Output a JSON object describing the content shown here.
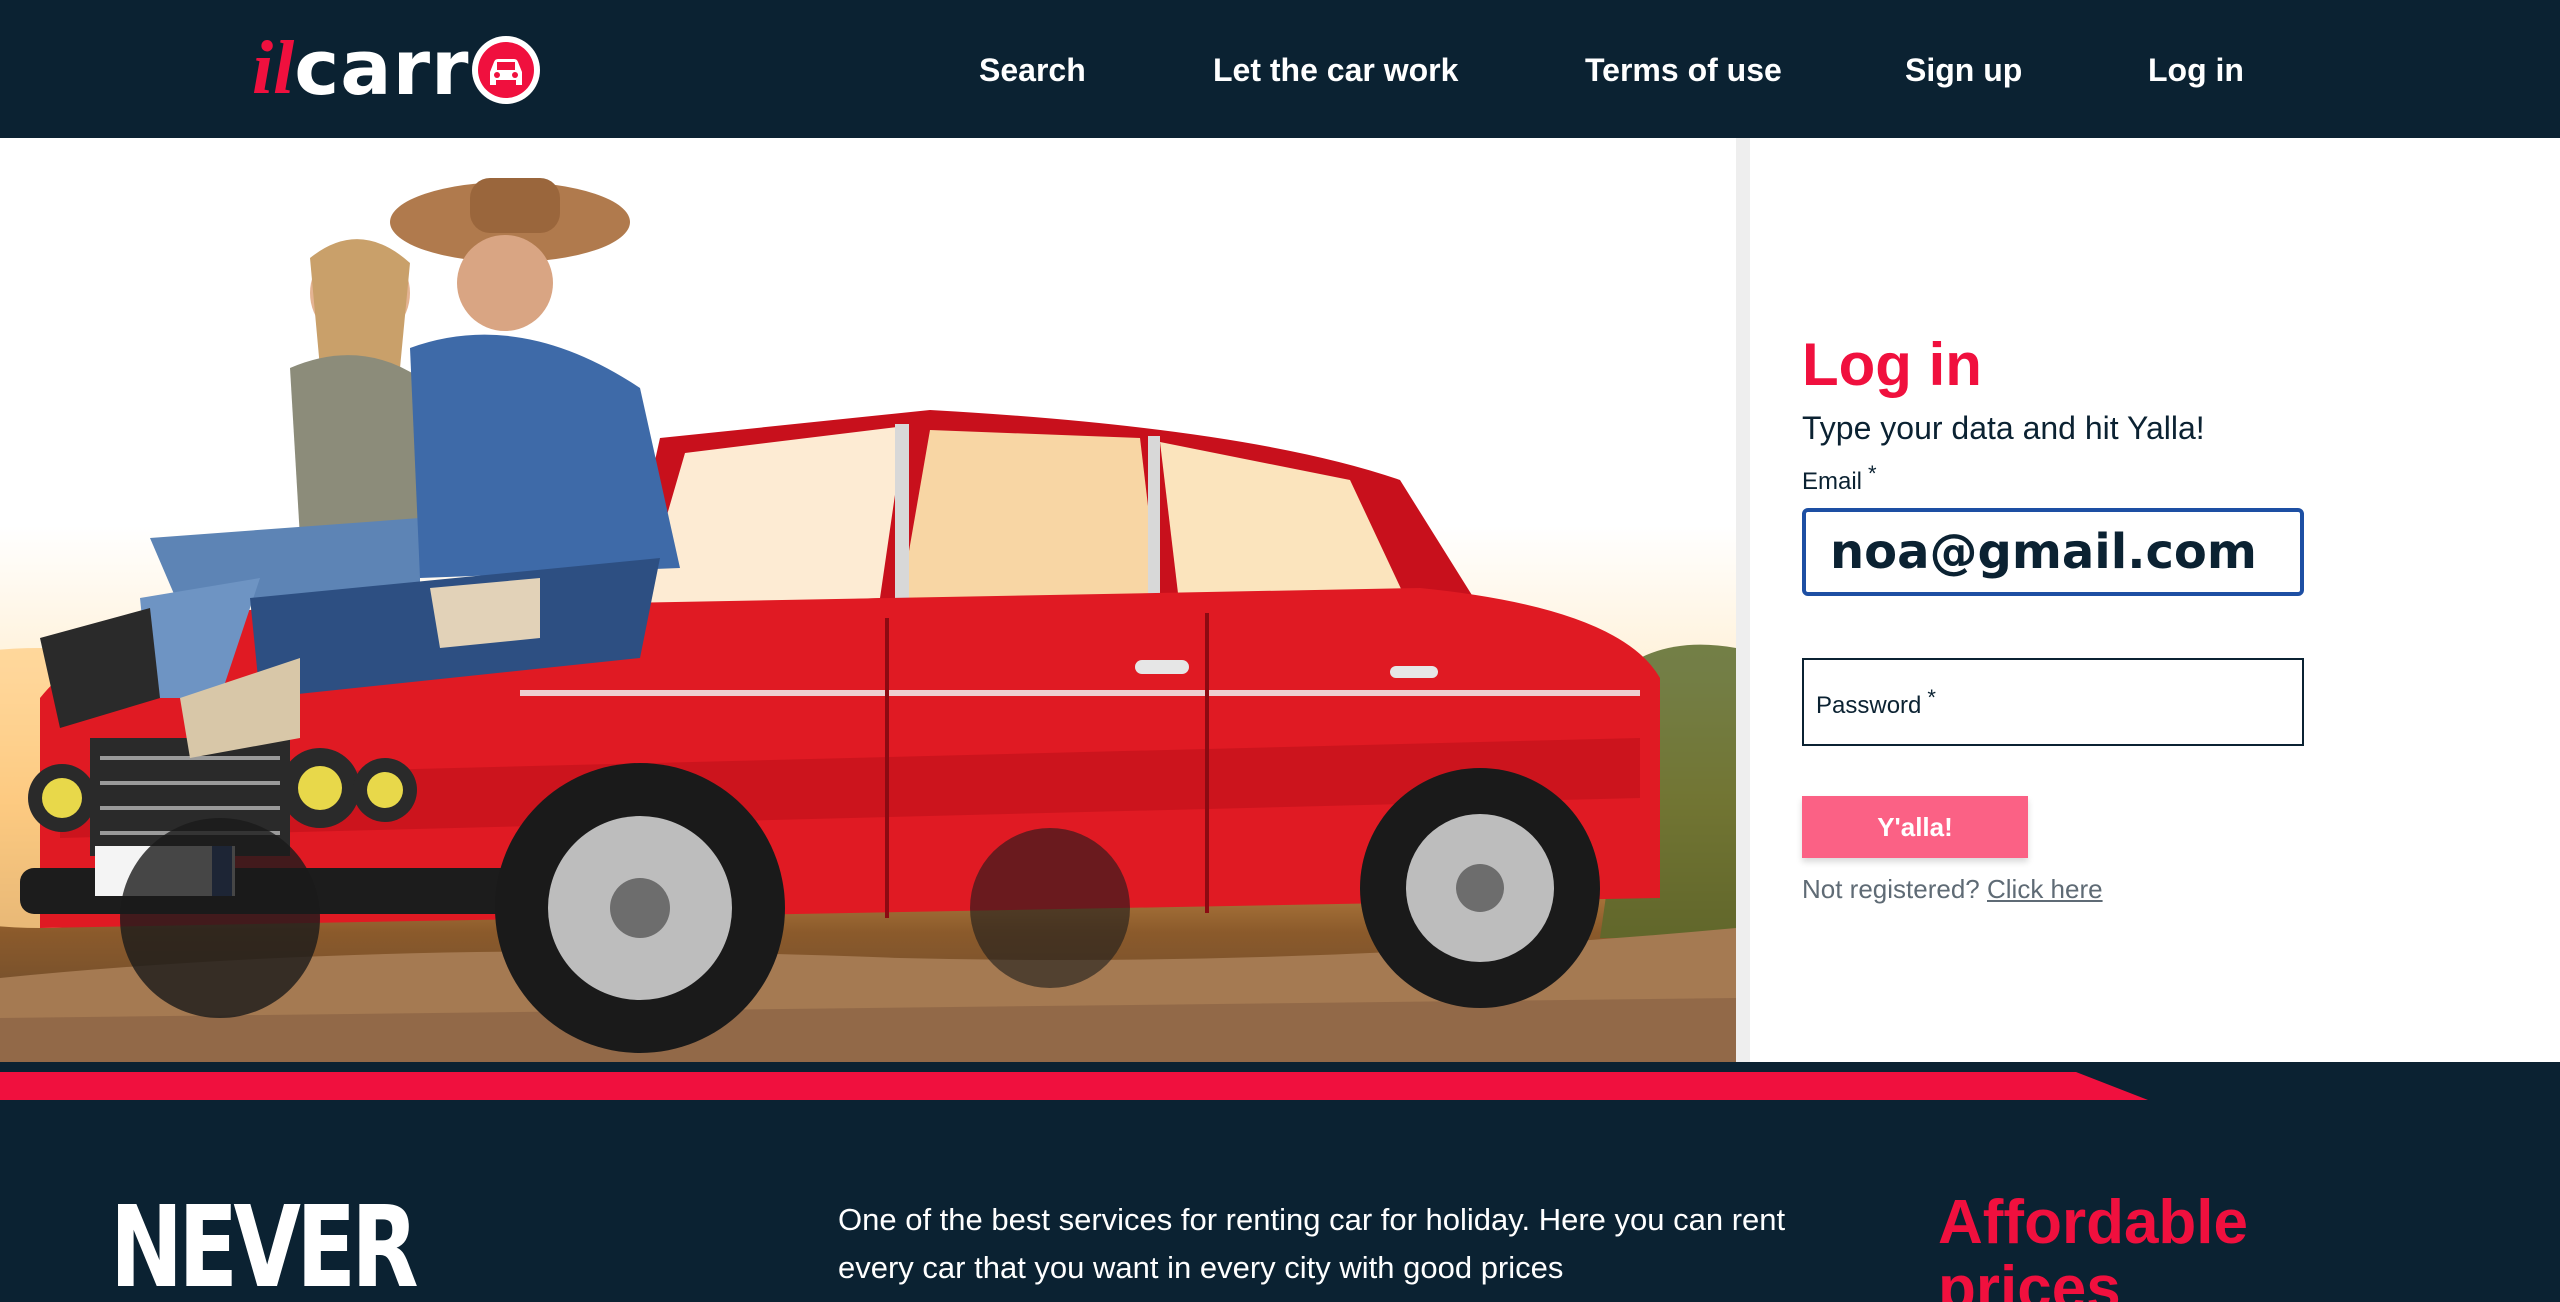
{
  "brand": {
    "logo_prefix": "il",
    "logo_main": "carr",
    "colors": {
      "accent": "#f0103e",
      "navy": "#0b2232",
      "button": "#fb6185",
      "focus": "#1d4fa3"
    }
  },
  "nav": {
    "items": [
      {
        "label": "Search"
      },
      {
        "label": "Let the car work"
      },
      {
        "label": "Terms of use"
      },
      {
        "label": "Sign up"
      },
      {
        "label": "Log in"
      }
    ]
  },
  "login": {
    "title": "Log in",
    "subtitle": "Type your data and hit Yalla!",
    "email_label": "Email",
    "email_value": "noa@gmail.com",
    "password_label": "Password",
    "required_mark": "*",
    "submit_label": "Y'alla!",
    "not_registered_text": "Not registered?",
    "click_here_label": "Click here"
  },
  "footer": {
    "headline": "NEVER",
    "description": "One of the best services for renting car for holiday. Here you can rent every car that you want in every city with good prices",
    "feature_title": "Affordable prices"
  },
  "icons": [
    "car-icon",
    "hero-photo"
  ]
}
